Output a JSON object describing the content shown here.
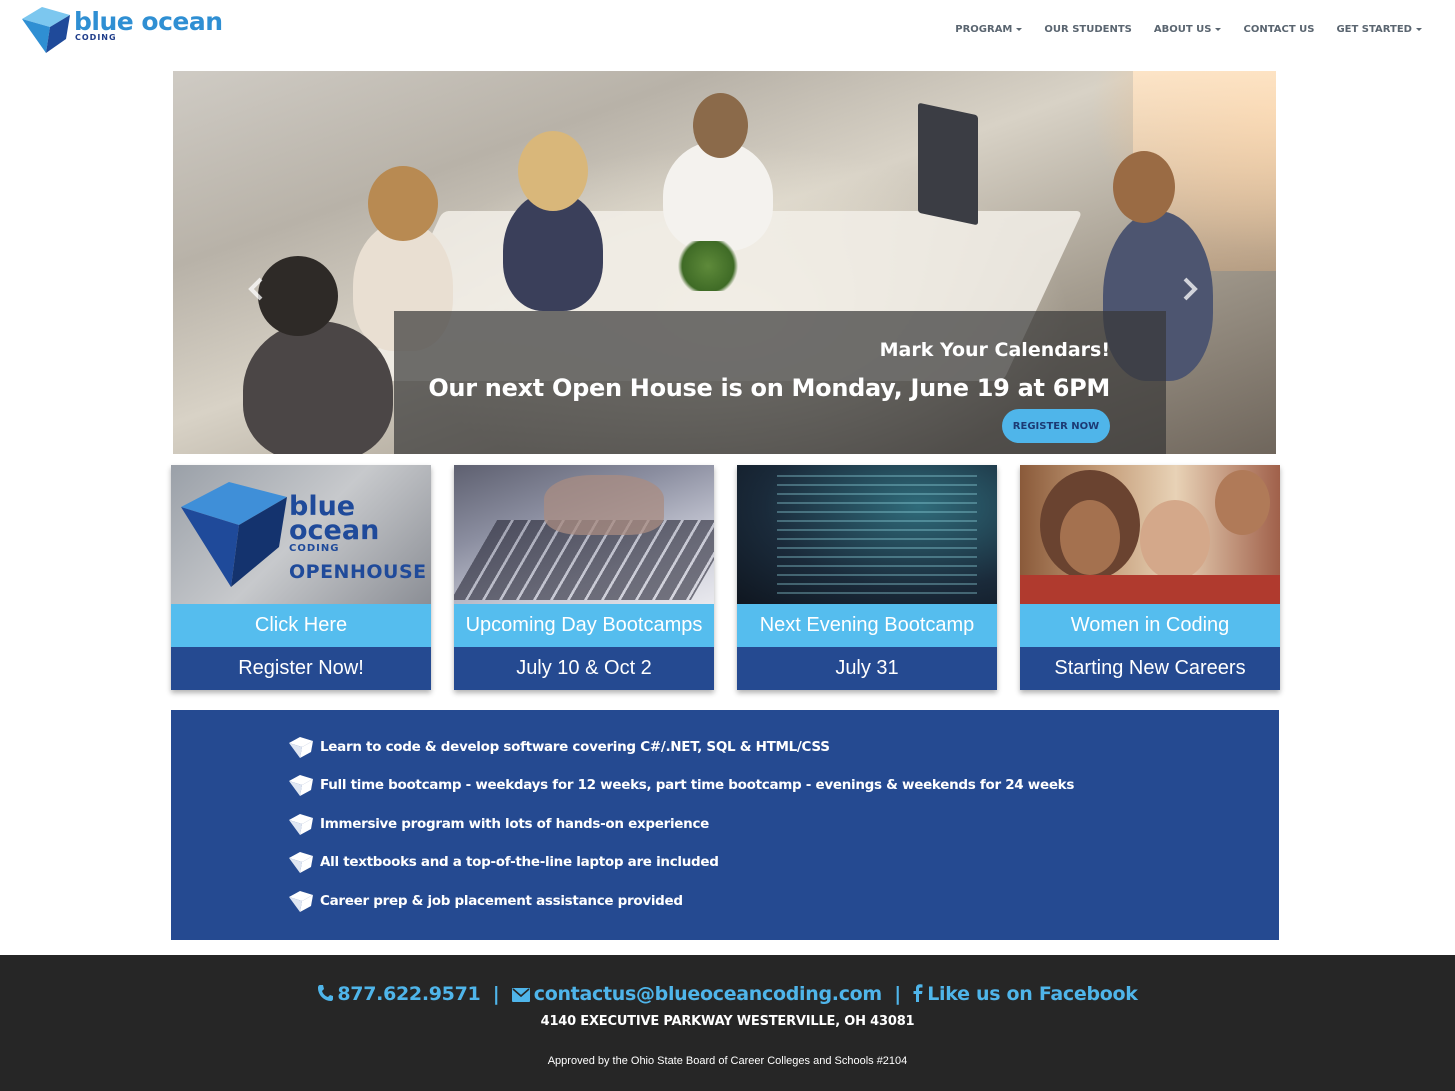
{
  "brand": {
    "name": "blue ocean",
    "sub": "CODING",
    "colors": {
      "primary": "#254a91",
      "accent": "#55bdee",
      "logo": "#2f8fd3"
    }
  },
  "nav": {
    "items": [
      {
        "label": "PROGRAM",
        "dropdown": true
      },
      {
        "label": "OUR STUDENTS",
        "dropdown": false
      },
      {
        "label": "ABOUT US",
        "dropdown": true
      },
      {
        "label": "CONTACT US",
        "dropdown": false
      },
      {
        "label": "GET STARTED",
        "dropdown": true
      }
    ]
  },
  "hero": {
    "subtitle": "Mark Your Calendars!",
    "title": "Our next Open House is on Monday, June 19 at 6PM",
    "button": "REGISTER NOW",
    "prev_icon": "chevron-left-icon",
    "next_icon": "chevron-right-icon"
  },
  "cards": [
    {
      "image_words": {
        "brand": "blue ocean",
        "coding": "CODING",
        "event": "OPENHOUSE"
      },
      "top": "Click Here",
      "bottom": "Register Now!"
    },
    {
      "top": "Upcoming Day Bootcamps",
      "bottom": "July 10 & Oct 2"
    },
    {
      "top": "Next Evening Bootcamp",
      "bottom": "July 31"
    },
    {
      "top": "Women in Coding",
      "bottom": "Starting New Careers"
    }
  ],
  "features": [
    "Learn to code & develop software covering C#/.NET, SQL & HTML/CSS",
    "Full time bootcamp - weekdays for 12 weeks, part time bootcamp - evenings & weekends for 24 weeks",
    "Immersive program with lots of hands-on experience",
    "All textbooks and a top-of-the-line laptop are included",
    "Career prep & job placement assistance provided"
  ],
  "footer": {
    "phone": "877.622.9571",
    "email": "contactus@blueoceancoding.com",
    "facebook": "Like us on Facebook",
    "separator": "|",
    "address": "4140 EXECUTIVE PARKWAY WESTERVILLE, OH 43081",
    "approved": "Approved by the Ohio State Board of Career Colleges and Schools #2104"
  }
}
